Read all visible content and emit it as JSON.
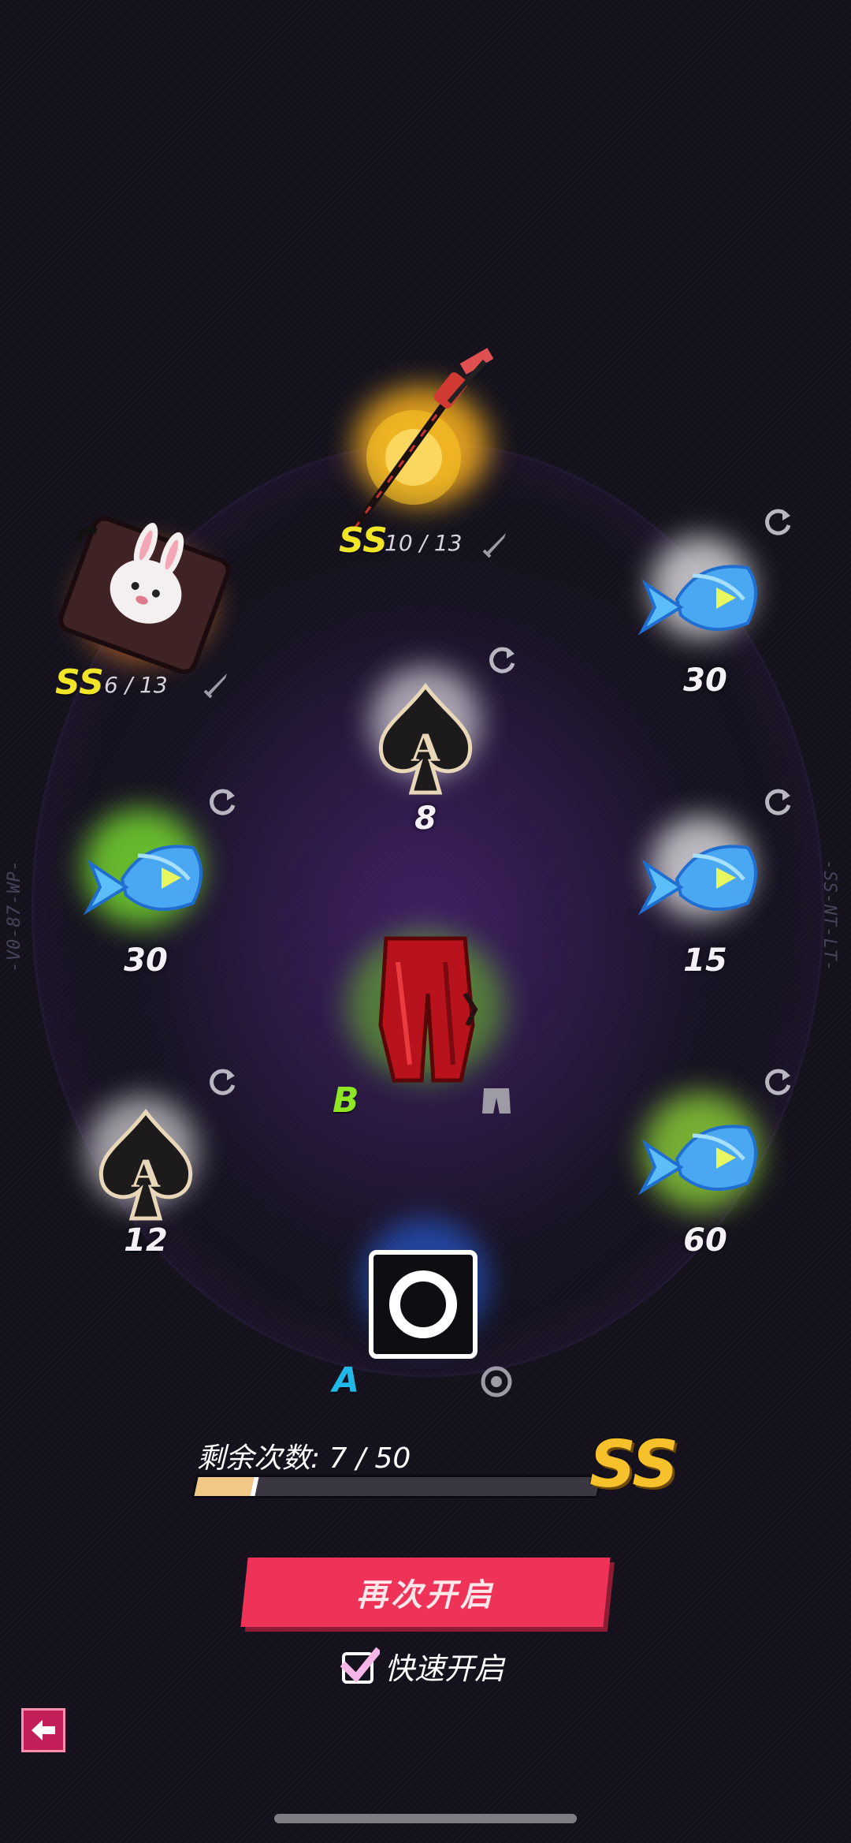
{
  "side_codes": {
    "left": "-V0-87-WP-",
    "right": "-SS-NT-LT-"
  },
  "slots": [
    {
      "id": "staff",
      "grade": "SS",
      "grade_color": "#f1e528",
      "progress": "10 / 13",
      "type_icon": "sword-icon",
      "art": "staff"
    },
    {
      "id": "bag",
      "grade": "SS",
      "grade_color": "#f1e528",
      "progress": "6 / 13",
      "type_icon": "sword-icon",
      "art": "bunny-bag"
    },
    {
      "id": "fish-top-right",
      "count": "30",
      "refresh_icon": "refresh-icon",
      "art": "fish",
      "glow": "#ffffff"
    },
    {
      "id": "ace-center",
      "count": "8",
      "refresh_icon": "refresh-icon",
      "art": "ace",
      "glow": "#ffffff"
    },
    {
      "id": "fish-left",
      "count": "30",
      "refresh_icon": "refresh-icon",
      "art": "fish",
      "glow": "#8ef23a"
    },
    {
      "id": "fish-right",
      "count": "15",
      "refresh_icon": "refresh-icon",
      "art": "fish",
      "glow": "#ffffff"
    },
    {
      "id": "pants",
      "grade": "B",
      "grade_color": "#8ee625",
      "type_icon": "pants-icon",
      "art": "red-pants"
    },
    {
      "id": "ace-left",
      "count": "12",
      "refresh_icon": "refresh-icon",
      "art": "ace",
      "glow": "#ffffff"
    },
    {
      "id": "fish-bottom-right",
      "count": "60",
      "refresh_icon": "refresh-icon",
      "art": "fish",
      "glow": "#a6f23a"
    },
    {
      "id": "ring",
      "grade": "A",
      "grade_color": "#20b8e8",
      "type_icon": "ring-icon",
      "art": "ring-box"
    }
  ],
  "remaining": {
    "label": "剩余次数: 7 / 50",
    "fraction": 0.14,
    "grade": "SS"
  },
  "open_again_label": "再次开启",
  "quick_open": {
    "label": "快速开启",
    "checked": true
  },
  "back_icon": "arrow-left-icon"
}
